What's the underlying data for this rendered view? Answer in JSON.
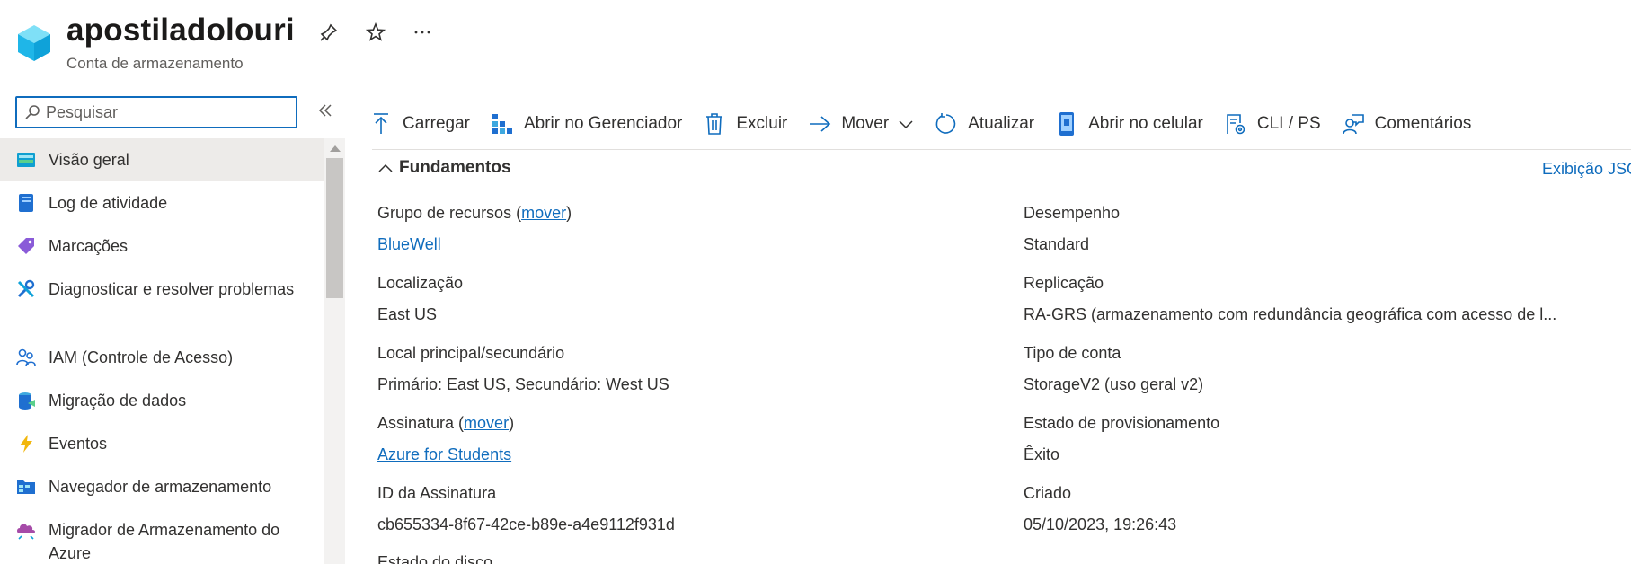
{
  "header": {
    "title": "apostiladolouri",
    "subtitle": "Conta de armazenamento"
  },
  "search": {
    "placeholder": "Pesquisar",
    "value": ""
  },
  "sidebar": {
    "items": [
      {
        "label": "Visão geral",
        "icon": "overview-icon"
      },
      {
        "label": "Log de atividade",
        "icon": "activity-log-icon"
      },
      {
        "label": "Marcações",
        "icon": "tags-icon"
      },
      {
        "label": "Diagnosticar e resolver problemas",
        "icon": "wrench-icon"
      },
      {
        "label": "IAM (Controle de Acesso)",
        "icon": "people-icon"
      },
      {
        "label": "Migração de dados",
        "icon": "data-migration-icon"
      },
      {
        "label": "Eventos",
        "icon": "lightning-icon"
      },
      {
        "label": "Navegador de armazenamento",
        "icon": "storage-browser-icon"
      },
      {
        "label": "Migrador de Armazenamento do Azure",
        "icon": "cloud-migrator-icon"
      }
    ]
  },
  "toolbar": {
    "upload": "Carregar",
    "open_explorer": "Abrir no Gerenciador",
    "delete": "Excluir",
    "move": "Mover",
    "refresh": "Atualizar",
    "open_mobile": "Abrir no celular",
    "cli": "CLI / PS",
    "feedback": "Comentários"
  },
  "essentials": {
    "title": "Fundamentos",
    "json_view": "Exibição JSON",
    "resource_group_label": "Grupo de recursos (",
    "move_link": "mover",
    "close_paren": ")",
    "resource_group_value": "BlueWell",
    "location_label": "Localização",
    "location_value": "East US",
    "primary_secondary_label": "Local principal/secundário",
    "primary_secondary_value": "Primário: East US, Secundário: West US",
    "subscription_label": "Assinatura (",
    "subscription_value": "Azure for Students",
    "subscription_id_label": "ID da Assinatura",
    "subscription_id_value": "cb655334-8f67-42ce-b89e-a4e9112f931d",
    "disk_state_label": "Estado do disco",
    "performance_label": "Desempenho",
    "performance_value": "Standard",
    "replication_label": "Replicação",
    "replication_value": "RA-GRS (armazenamento com redundância geográfica com acesso de l...",
    "account_kind_label": "Tipo de conta",
    "account_kind_value": "StorageV2 (uso geral v2)",
    "provisioning_label": "Estado de provisionamento",
    "provisioning_value": "Êxito",
    "created_label": "Criado",
    "created_value": "05/10/2023, 19:26:43"
  },
  "colors": {
    "accent": "#0f6cbd",
    "active_bg": "#edebe9"
  }
}
